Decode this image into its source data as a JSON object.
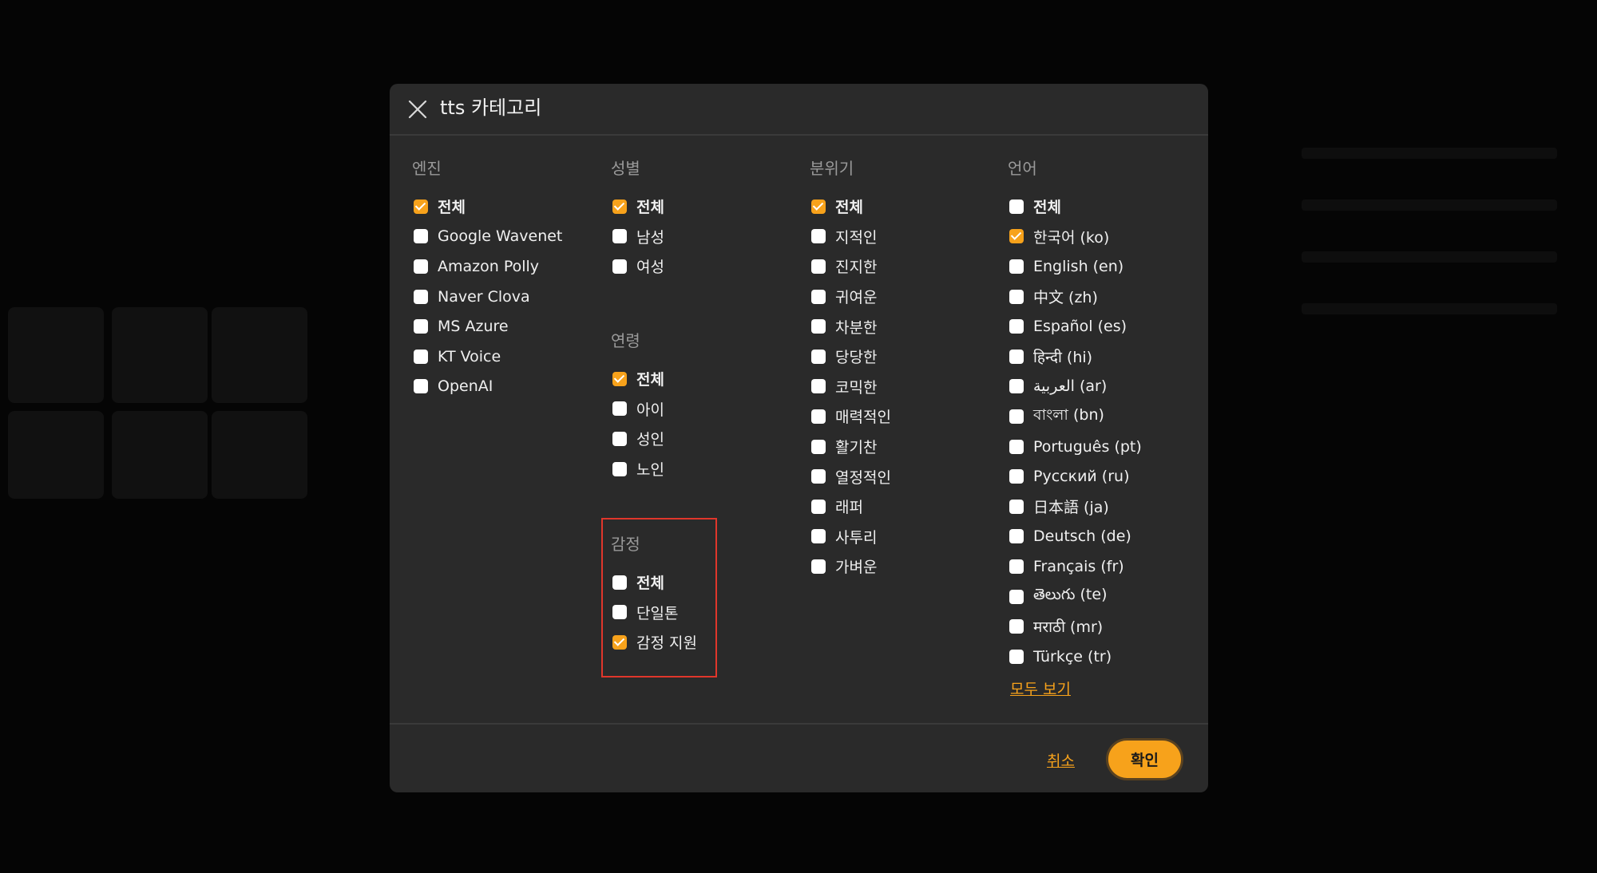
{
  "modal": {
    "title": "tts 카테고리",
    "close_icon": "close-icon"
  },
  "groups": {
    "engine": {
      "title": "엔진",
      "options": [
        {
          "label": "전체",
          "checked": true
        },
        {
          "label": "Google Wavenet",
          "checked": false
        },
        {
          "label": "Amazon Polly",
          "checked": false
        },
        {
          "label": "Naver Clova",
          "checked": false
        },
        {
          "label": "MS Azure",
          "checked": false
        },
        {
          "label": "KT Voice",
          "checked": false
        },
        {
          "label": "OpenAI",
          "checked": false
        }
      ]
    },
    "gender": {
      "title": "성별",
      "options": [
        {
          "label": "전체",
          "checked": true
        },
        {
          "label": "남성",
          "checked": false
        },
        {
          "label": "여성",
          "checked": false
        }
      ]
    },
    "age": {
      "title": "연령",
      "options": [
        {
          "label": "전체",
          "checked": true
        },
        {
          "label": "아이",
          "checked": false
        },
        {
          "label": "성인",
          "checked": false
        },
        {
          "label": "노인",
          "checked": false
        }
      ]
    },
    "emotion": {
      "title": "감정",
      "options": [
        {
          "label": "전체",
          "checked": false
        },
        {
          "label": "단일톤",
          "checked": false
        },
        {
          "label": "감정 지원",
          "checked": true
        }
      ]
    },
    "mood": {
      "title": "분위기",
      "options": [
        {
          "label": "전체",
          "checked": true
        },
        {
          "label": "지적인",
          "checked": false
        },
        {
          "label": "진지한",
          "checked": false
        },
        {
          "label": "귀여운",
          "checked": false
        },
        {
          "label": "차분한",
          "checked": false
        },
        {
          "label": "당당한",
          "checked": false
        },
        {
          "label": "코믹한",
          "checked": false
        },
        {
          "label": "매력적인",
          "checked": false
        },
        {
          "label": "활기찬",
          "checked": false
        },
        {
          "label": "열정적인",
          "checked": false
        },
        {
          "label": "래퍼",
          "checked": false
        },
        {
          "label": "사투리",
          "checked": false
        },
        {
          "label": "가벼운",
          "checked": false
        }
      ]
    },
    "language": {
      "title": "언어",
      "options": [
        {
          "label": "전체",
          "checked": false
        },
        {
          "label": "한국어 (ko)",
          "checked": true
        },
        {
          "label": "English (en)",
          "checked": false
        },
        {
          "label": "中文 (zh)",
          "checked": false
        },
        {
          "label": "Español (es)",
          "checked": false
        },
        {
          "label": "हिन्दी (hi)",
          "checked": false
        },
        {
          "label": "العربية (ar)",
          "checked": false
        },
        {
          "label": "বাংলা (bn)",
          "checked": false
        },
        {
          "label": "Português (pt)",
          "checked": false
        },
        {
          "label": "Русский (ru)",
          "checked": false
        },
        {
          "label": "日本語 (ja)",
          "checked": false
        },
        {
          "label": "Deutsch (de)",
          "checked": false
        },
        {
          "label": "Français (fr)",
          "checked": false
        },
        {
          "label": "తెలుగు (te)",
          "checked": false
        },
        {
          "label": "मराठी (mr)",
          "checked": false
        },
        {
          "label": "Türkçe (tr)",
          "checked": false
        }
      ],
      "view_all": "모두 보기"
    }
  },
  "footer": {
    "cancel": "취소",
    "confirm": "확인"
  },
  "colors": {
    "accent": "#f7a21b",
    "highlight": "#e0362b",
    "modal_bg": "#2a2a2a"
  }
}
